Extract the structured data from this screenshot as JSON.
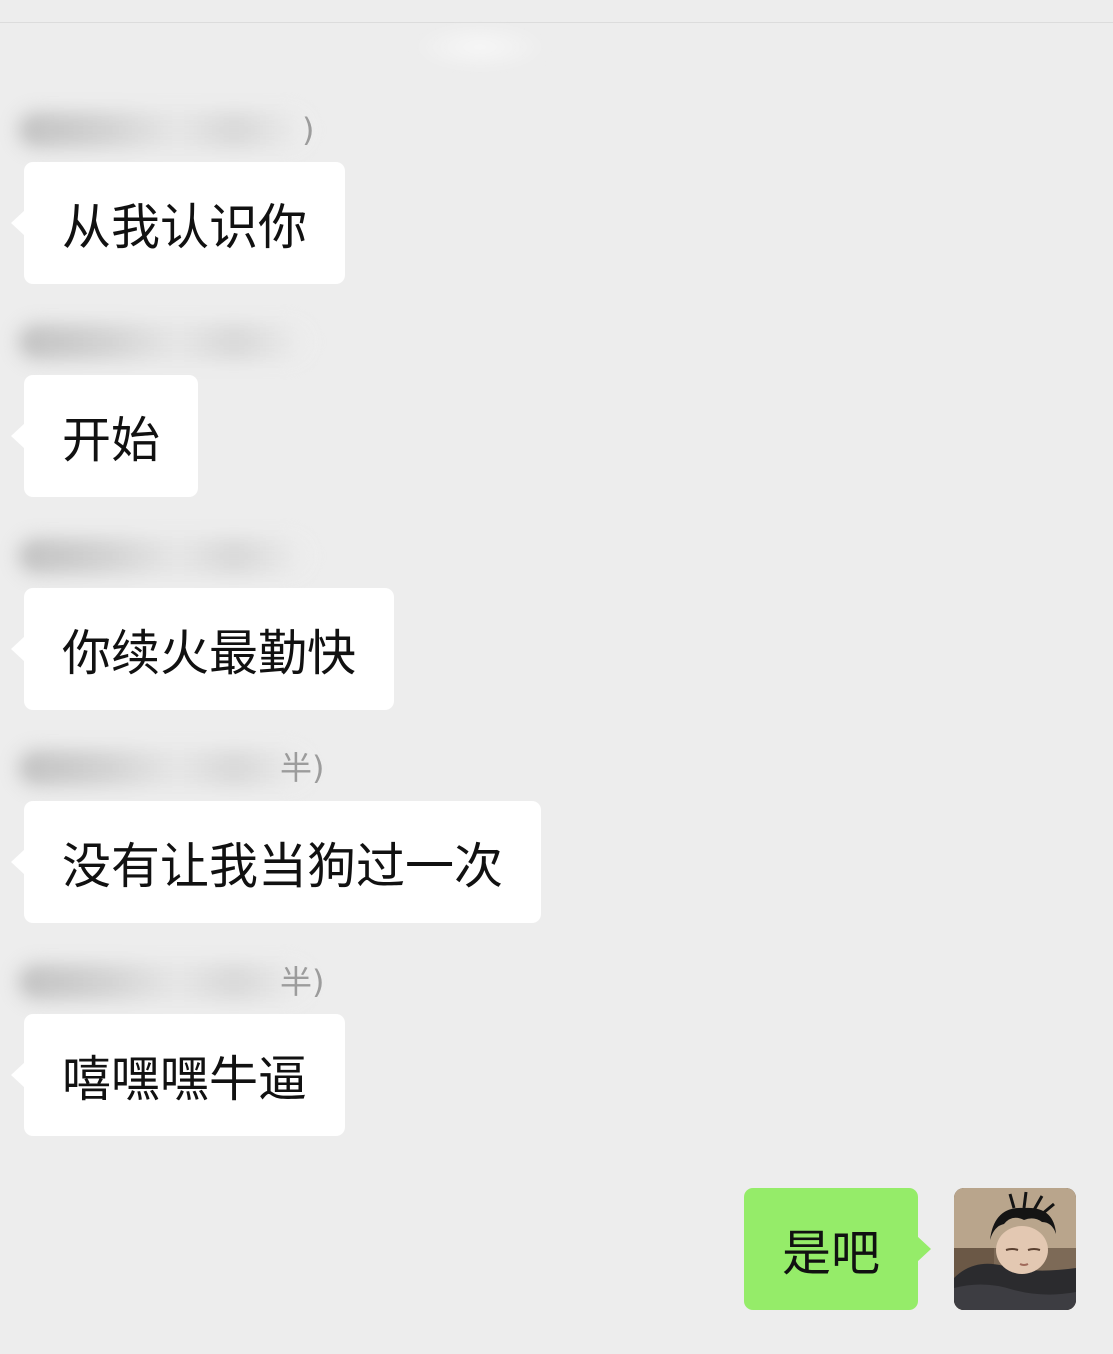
{
  "chat": {
    "messages": [
      {
        "sender_suffix": ")",
        "text": "从我认识你"
      },
      {
        "sender_suffix": "",
        "text": "开始"
      },
      {
        "sender_suffix": "",
        "text": "你续火最勤快"
      },
      {
        "sender_suffix": "⁠半)",
        "text": "没有让我当狗过一次"
      },
      {
        "sender_suffix": "半)",
        "text": "嘻嘿嘿牛逼"
      }
    ],
    "my_message": {
      "text": "是吧"
    }
  },
  "colors": {
    "background": "#ededed",
    "incoming_bubble": "#ffffff",
    "outgoing_bubble": "#95ec69"
  }
}
